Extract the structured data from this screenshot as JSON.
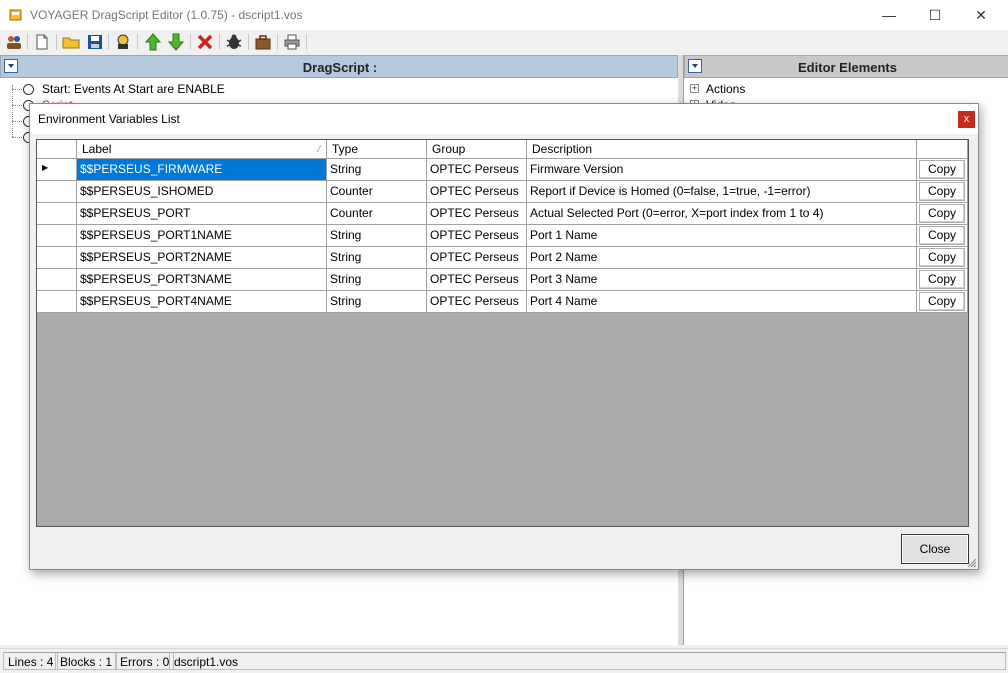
{
  "window": {
    "title": "VOYAGER DragScript Editor (1.0.75) - dscript1.vos",
    "min_glyph": "—",
    "max_glyph": "☐",
    "close_glyph": "✕"
  },
  "toolbar": {
    "icons": [
      "users-icon",
      "new-file-icon",
      "open-folder-icon",
      "save-icon",
      "wizard-icon",
      "move-up-icon",
      "move-down-icon",
      "delete-icon",
      "bug-icon",
      "toolbox-icon",
      "print-icon"
    ]
  },
  "left_panel": {
    "title": "DragScript :",
    "tree": [
      {
        "label": "Start: Events At Start are ENABLE"
      },
      {
        "label": "Script"
      }
    ]
  },
  "right_panel": {
    "title": "Editor Elements",
    "tree": [
      {
        "label": "Actions"
      },
      {
        "label": "Video"
      }
    ]
  },
  "dialog": {
    "title": "Environment Variables List",
    "close_glyph": "x",
    "columns": [
      "Label",
      "Type",
      "Group",
      "Description",
      ""
    ],
    "copy_label": "Copy",
    "rows": [
      {
        "label": "$$PERSEUS_FIRMWARE",
        "type": "String",
        "group": "OPTEC Perseus",
        "description": "Firmware Version"
      },
      {
        "label": "$$PERSEUS_ISHOMED",
        "type": "Counter",
        "group": "OPTEC Perseus",
        "description": "Report if Device is Homed (0=false, 1=true, -1=error)"
      },
      {
        "label": "$$PERSEUS_PORT",
        "type": "Counter",
        "group": "OPTEC Perseus",
        "description": "Actual Selected Port (0=error, X=port index from 1 to 4)"
      },
      {
        "label": "$$PERSEUS_PORT1NAME",
        "type": "String",
        "group": "OPTEC Perseus",
        "description": "Port 1 Name"
      },
      {
        "label": "$$PERSEUS_PORT2NAME",
        "type": "String",
        "group": "OPTEC Perseus",
        "description": "Port 2 Name"
      },
      {
        "label": "$$PERSEUS_PORT3NAME",
        "type": "String",
        "group": "OPTEC Perseus",
        "description": "Port 3 Name"
      },
      {
        "label": "$$PERSEUS_PORT4NAME",
        "type": "String",
        "group": "OPTEC Perseus",
        "description": "Port 4 Name"
      }
    ],
    "close_label": "Close"
  },
  "statusbar": {
    "lines": "Lines : 4",
    "blocks": "Blocks : 1",
    "errors": "Errors : 0",
    "file": "dscript1.vos"
  },
  "colors": {
    "selection": "#0078d7",
    "left_header": "#b4c8de",
    "grid_background": "#ababab",
    "dialog_close": "#c42b1c"
  }
}
